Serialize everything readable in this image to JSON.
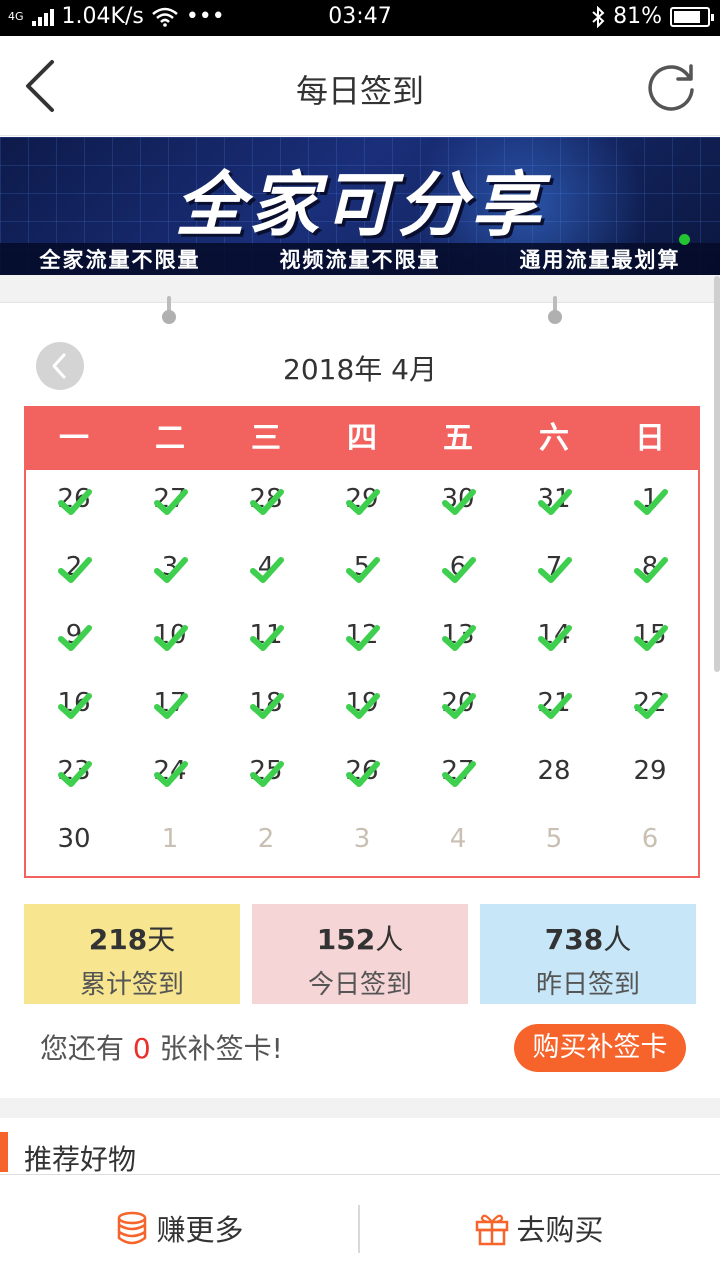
{
  "status_bar": {
    "network": "4G",
    "speed": "1.04K/s",
    "more": "•••",
    "time": "03:47",
    "battery": "81%",
    "battery_level": 0.81
  },
  "header": {
    "title": "每日签到"
  },
  "banner": {
    "headline": "全家可分享",
    "taglines": [
      "全家流量不限量",
      "视频流量不限量",
      "通用流量最划算"
    ]
  },
  "calendar": {
    "month_title": "2018年 4月",
    "weekdays": [
      "一",
      "二",
      "三",
      "四",
      "五",
      "六",
      "日"
    ],
    "days": [
      {
        "label": "26",
        "other": false,
        "checked": true
      },
      {
        "label": "27",
        "other": false,
        "checked": true
      },
      {
        "label": "28",
        "other": false,
        "checked": true
      },
      {
        "label": "29",
        "other": false,
        "checked": true
      },
      {
        "label": "30",
        "other": false,
        "checked": true
      },
      {
        "label": "31",
        "other": false,
        "checked": true
      },
      {
        "label": "1",
        "other": false,
        "checked": true
      },
      {
        "label": "2",
        "other": false,
        "checked": true
      },
      {
        "label": "3",
        "other": false,
        "checked": true
      },
      {
        "label": "4",
        "other": false,
        "checked": true
      },
      {
        "label": "5",
        "other": false,
        "checked": true
      },
      {
        "label": "6",
        "other": false,
        "checked": true
      },
      {
        "label": "7",
        "other": false,
        "checked": true
      },
      {
        "label": "8",
        "other": false,
        "checked": true
      },
      {
        "label": "9",
        "other": false,
        "checked": true
      },
      {
        "label": "10",
        "other": false,
        "checked": true
      },
      {
        "label": "11",
        "other": false,
        "checked": true
      },
      {
        "label": "12",
        "other": false,
        "checked": true
      },
      {
        "label": "13",
        "other": false,
        "checked": true
      },
      {
        "label": "14",
        "other": false,
        "checked": true
      },
      {
        "label": "15",
        "other": false,
        "checked": true
      },
      {
        "label": "16",
        "other": false,
        "checked": true
      },
      {
        "label": "17",
        "other": false,
        "checked": true
      },
      {
        "label": "18",
        "other": false,
        "checked": true
      },
      {
        "label": "19",
        "other": false,
        "checked": true
      },
      {
        "label": "20",
        "other": false,
        "checked": true
      },
      {
        "label": "21",
        "other": false,
        "checked": true
      },
      {
        "label": "22",
        "other": false,
        "checked": true
      },
      {
        "label": "23",
        "other": false,
        "checked": true
      },
      {
        "label": "24",
        "other": false,
        "checked": true
      },
      {
        "label": "25",
        "other": false,
        "checked": true
      },
      {
        "label": "26",
        "other": false,
        "checked": true
      },
      {
        "label": "27",
        "other": false,
        "checked": true
      },
      {
        "label": "28",
        "other": false,
        "checked": false
      },
      {
        "label": "29",
        "other": false,
        "checked": false
      },
      {
        "label": "30",
        "other": false,
        "checked": false
      },
      {
        "label": "1",
        "other": true,
        "checked": false
      },
      {
        "label": "2",
        "other": true,
        "checked": false
      },
      {
        "label": "3",
        "other": true,
        "checked": false
      },
      {
        "label": "4",
        "other": true,
        "checked": false
      },
      {
        "label": "5",
        "other": true,
        "checked": false
      },
      {
        "label": "6",
        "other": true,
        "checked": false
      }
    ]
  },
  "stats": {
    "total": {
      "value": "218",
      "unit": "天",
      "label": "累计签到"
    },
    "today": {
      "value": "152",
      "unit": "人",
      "label": "今日签到"
    },
    "yesterday": {
      "value": "738",
      "unit": "人",
      "label": "昨日签到"
    }
  },
  "makeup_cards": {
    "prefix": "您还有",
    "count": "0",
    "suffix": "张补签卡!",
    "buy_label": "购买补签卡"
  },
  "recommend": {
    "title": "推荐好物"
  },
  "tabbar": {
    "earn_label": "赚更多",
    "shop_label": "去购买"
  },
  "colors": {
    "calendar_red": "#f2625e",
    "check_green": "#3fcf4f",
    "accent_orange": "#f7642b",
    "stat_yellow": "#f8e58f",
    "stat_pink": "#f6d5d6",
    "stat_blue": "#c7e6f8"
  },
  "icons": {
    "back": "chevron-left-icon",
    "refresh": "refresh-icon",
    "month_prev": "chevron-left-icon",
    "check": "checkmark-icon",
    "coins": "coins-icon",
    "gift": "gift-icon",
    "bluetooth": "bluetooth-icon",
    "wifi": "wifi-icon"
  }
}
